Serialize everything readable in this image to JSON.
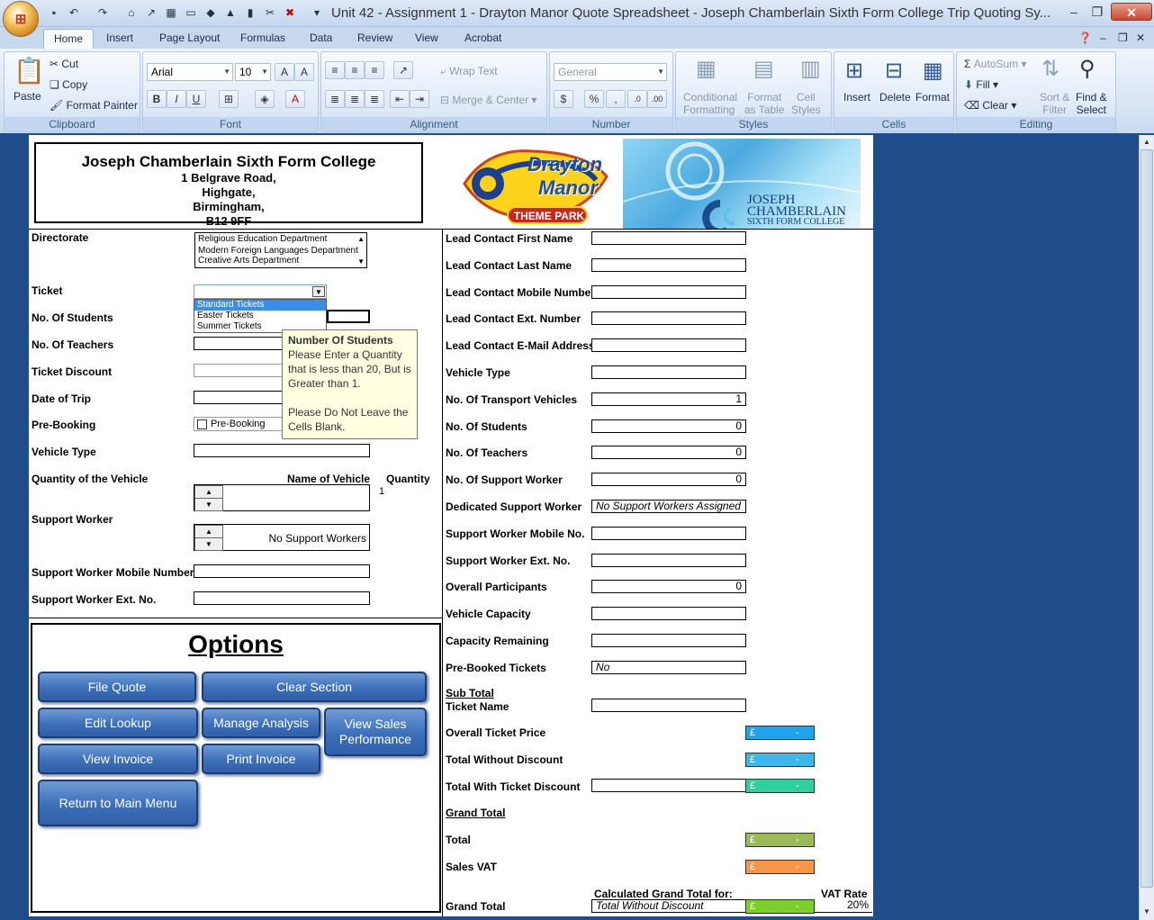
{
  "window": {
    "title": "Unit 42 - Assignment 1 - Drayton Manor Quote Spreadsheet - Joseph Chamberlain Sixth Form College Trip Quoting Sy..."
  },
  "ribbon": {
    "tabs": [
      "Home",
      "Insert",
      "Page Layout",
      "Formulas",
      "Data",
      "Review",
      "View",
      "Acrobat"
    ],
    "clipboard": {
      "paste": "Paste",
      "cut": "Cut",
      "copy": "Copy",
      "format_painter": "Format Painter",
      "name": "Clipboard"
    },
    "font": {
      "family": "Arial",
      "size": "10",
      "name": "Font"
    },
    "alignment": {
      "wrap": "Wrap Text",
      "merge": "Merge & Center",
      "name": "Alignment"
    },
    "number": {
      "format": "General",
      "name": "Number"
    },
    "styles": {
      "conditional_1": "Conditional",
      "conditional_2": "Formatting",
      "format_table_1": "Format",
      "format_table_2": "as Table",
      "cell_styles_1": "Cell",
      "cell_styles_2": "Styles",
      "name": "Styles"
    },
    "cells": {
      "insert": "Insert",
      "delete": "Delete",
      "format": "Format",
      "name": "Cells"
    },
    "editing": {
      "autosum": "AutoSum",
      "fill": "Fill",
      "clear": "Clear",
      "sort_1": "Sort &",
      "sort_2": "Filter",
      "find_1": "Find &",
      "find_2": "Select",
      "name": "Editing"
    }
  },
  "header": {
    "college_name": "Joseph Chamberlain Sixth Form College",
    "address": [
      "1 Belgrave  Road,",
      "Highgate,",
      "Birmingham,",
      "B12 9FF"
    ],
    "logo_drayton": {
      "line1": "Drayton",
      "line2": "Manor",
      "badge": "THEME PARK"
    },
    "logo_jc": {
      "line1": "JOSEPH",
      "line2": "CHAMBERLAIN",
      "line3": "SIXTH FORM COLLEGE"
    }
  },
  "left_form": {
    "directorate_label": "Directorate",
    "directorate_options": [
      "Religious Education Department",
      "Modern Foreign Languages Department",
      "Creative Arts Department"
    ],
    "ticket_label": "Ticket",
    "ticket_options": [
      "Standard Tickets",
      "Easter Tickets",
      "Summer Tickets"
    ],
    "students_label": "No. Of Students",
    "teachers_label": "No. Of Teachers",
    "discount_label": "Ticket Discount",
    "date_label": "Date of Trip",
    "prebooking_label": "Pre-Booking",
    "prebooking_checkbox": "Pre-Booking",
    "vehicle_type_label": "Vehicle Type",
    "quantity_vehicle_label": "Quantity of the Vehicle",
    "name_of_vehicle_label": "Name of Vehicle",
    "quantity_label": "Quantity",
    "quantity_value": "1",
    "support_worker_label": "Support Worker",
    "support_worker_value": "No Support Workers",
    "sw_mobile_label": "Support Worker Mobile Number",
    "sw_ext_label": "Support Worker Ext. No."
  },
  "tooltip": {
    "title": "Number Of Students",
    "body": "Please Enter a Quantity that is less than 20, But is Greater than 1.",
    "note": "Please Do Not Leave the Cells Blank."
  },
  "options": {
    "title": "Options",
    "buttons": [
      "File Quote",
      "Clear Section",
      "Edit Lookup",
      "Manage Analysis",
      "View Sales Performance",
      "View Invoice",
      "Print Invoice",
      "Return to Main Menu"
    ]
  },
  "right_form": {
    "rows": [
      {
        "label": "Lead Contact First Name",
        "value": ""
      },
      {
        "label": "Lead Contact Last Name",
        "value": ""
      },
      {
        "label": "Lead Contact Mobile Number",
        "value": ""
      },
      {
        "label": "Lead Contact Ext. Number",
        "value": ""
      },
      {
        "label": "Lead Contact E-Mail Address",
        "value": ""
      },
      {
        "label": "Vehicle Type",
        "value": ""
      },
      {
        "label": "No. Of Transport Vehicles",
        "value": "1"
      },
      {
        "label": "No. Of Students",
        "value": "0"
      },
      {
        "label": "No. Of Teachers",
        "value": "0"
      },
      {
        "label": "No. Of Support Worker",
        "value": "0"
      },
      {
        "label": "Dedicated Support Worker",
        "value": "No Support Workers Assigned"
      },
      {
        "label": "Support Worker Mobile No.",
        "value": ""
      },
      {
        "label": "Support Worker Ext. No.",
        "value": ""
      },
      {
        "label": "Overall Participants",
        "value": "0"
      },
      {
        "label": "Vehicle Capacity",
        "value": ""
      },
      {
        "label": "Capacity Remaining",
        "value": ""
      },
      {
        "label": "Pre-Booked Tickets",
        "value": "No"
      }
    ],
    "sub_total_heading": "Sub Total",
    "ticket_name_label": "Ticket Name",
    "overall_ticket_label": "Overall Ticket Price",
    "total_without_label": "Total Without Discount",
    "total_with_label": "Total With Ticket Discount",
    "grand_total_heading": "Grand Total",
    "total_label": "Total",
    "vat_label": "Sales VAT",
    "calc_label": "Calculated Grand Total for:",
    "vat_rate_label": "VAT Rate",
    "grand_total_label": "Grand Total",
    "grand_total_basis": "Total Without Discount",
    "vat_rate": "20%",
    "currency_symbol": "£",
    "dash": "-",
    "colors": {
      "blue": "#1fa3ea",
      "light_blue": "#3fb7ec",
      "teal": "#2fcf9e",
      "olive": "#9bbb59",
      "orange": "#f79646",
      "green": "#7ccf2a"
    }
  }
}
